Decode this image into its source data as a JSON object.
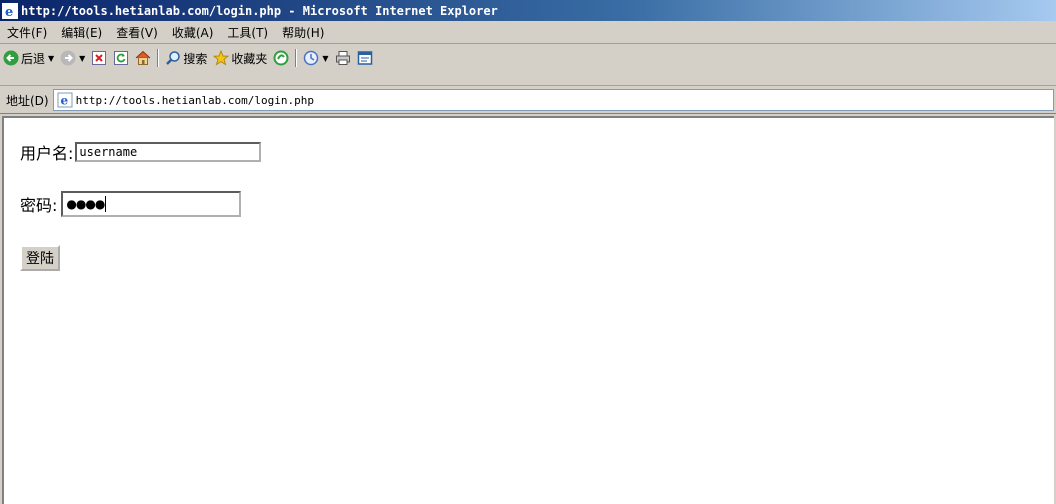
{
  "window": {
    "title": "http://tools.hetianlab.com/login.php - Microsoft Internet Explorer"
  },
  "menu": [
    "文件(F)",
    "编辑(E)",
    "查看(V)",
    "收藏(A)",
    "工具(T)",
    "帮助(H)"
  ],
  "toolbar": {
    "back_label": "后退",
    "search_label": "搜索",
    "favorites_label": "收藏夹"
  },
  "address": {
    "label": "地址(D)",
    "url": "http://tools.hetianlab.com/login.php"
  },
  "form": {
    "username_label": "用户名:",
    "username_value": "username",
    "password_label": "密码:",
    "password_mask": "●●●●",
    "submit_label": "登陆"
  },
  "colors": {
    "titlebar": "#0a246a",
    "chrome": "#d4d0c8",
    "page_bg": "#ffffff"
  }
}
